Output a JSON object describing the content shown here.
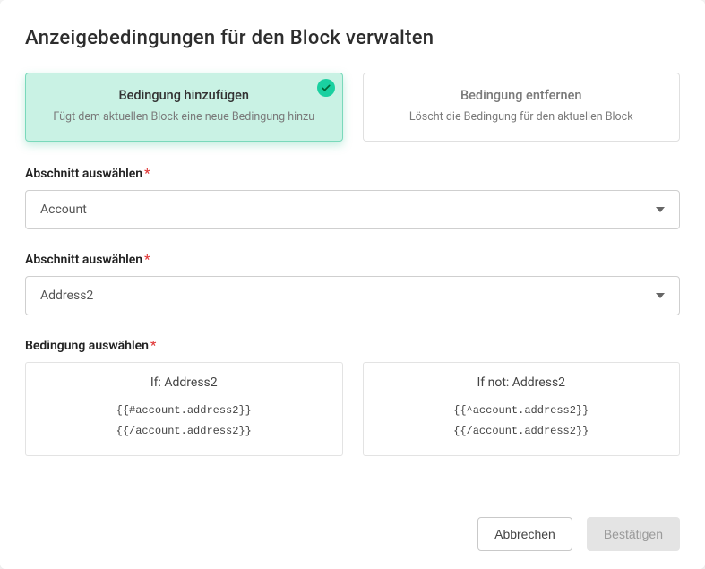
{
  "modal": {
    "title": "Anzeigebedingungen für den Block verwalten"
  },
  "options": {
    "add": {
      "title": "Bedingung hinzufügen",
      "desc": "Fügt dem aktuellen Block eine neue Bedingung hinzu"
    },
    "remove": {
      "title": "Bedingung entfernen",
      "desc": "Löscht die Bedingung für den aktuellen Block"
    }
  },
  "fields": {
    "section1": {
      "label": "Abschnitt auswählen",
      "value": "Account"
    },
    "section2": {
      "label": "Abschnitt auswählen",
      "value": "Address2"
    },
    "condition": {
      "label": "Bedingung auswählen"
    }
  },
  "conditions": {
    "if": {
      "title": "If: Address2",
      "line1": "{{#account.address2}}",
      "line2": "{{/account.address2}}"
    },
    "ifnot": {
      "title": "If not: Address2",
      "line1": "{{^account.address2}}",
      "line2": "{{/account.address2}}"
    }
  },
  "footer": {
    "cancel": "Abbrechen",
    "confirm": "Bestätigen"
  }
}
